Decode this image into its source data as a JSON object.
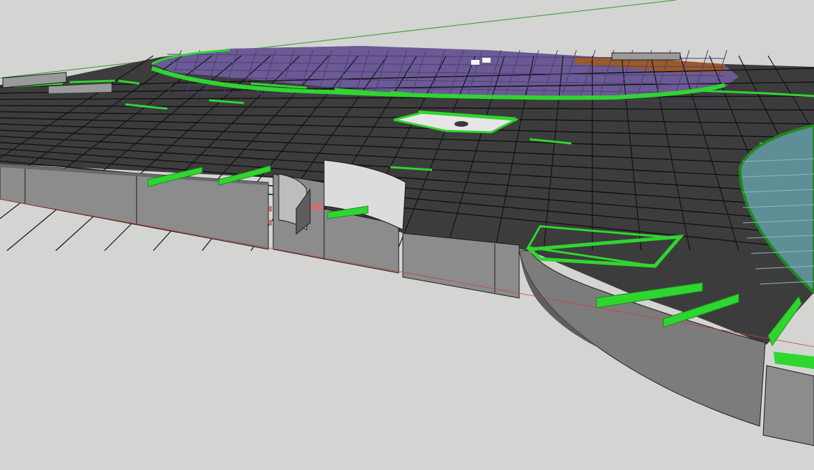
{
  "viewport": {
    "background": "#d4d4d2",
    "description_free": true
  },
  "colors": {
    "ground": "#d4d4d2",
    "block_top": "#3c3c3c",
    "block_edge": "#1a1a1a",
    "road_line": "#111111",
    "wall_light": "#9a9a9a",
    "wall_mid": "#7c7c7c",
    "wall_dark": "#5e5e5e",
    "green_strip": "#2fd62f",
    "green_dark": "#1c8a1c",
    "purple_block": "#6b5a96",
    "purple_dark": "#4a3f70",
    "orange_block": "#9a5a2c",
    "teal_dome": "#5f8f96",
    "teal_light": "#8fb7bc",
    "white_panel": "#e8e8e8",
    "axis_red": "#d23b3b",
    "axis_green": "#2e9a2e"
  }
}
